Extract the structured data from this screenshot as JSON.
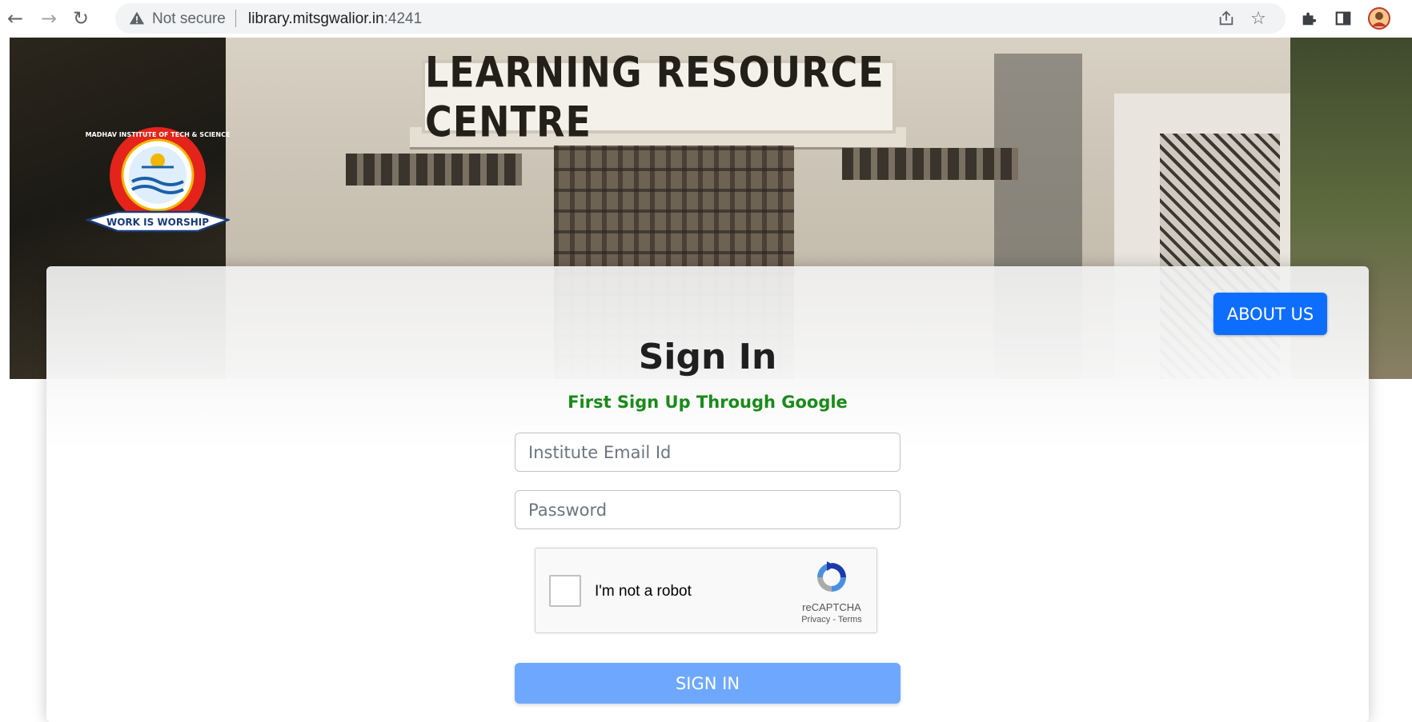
{
  "browser": {
    "back_icon": "arrow-left-icon",
    "forward_icon": "arrow-right-icon",
    "reload_icon": "reload-icon",
    "security_label": "Not secure",
    "url_host": "library.mitsgwalior.in",
    "url_port": ":4241",
    "share_icon": "share-icon",
    "bookmark_icon": "star-icon",
    "extensions_icon": "puzzle-icon",
    "sidepanel_icon": "side-panel-icon",
    "profile_icon": "profile-avatar-icon"
  },
  "hero": {
    "sign_text": "LEARNING RESOURCE CENTRE",
    "logo_top_text": "MADHAV INSTITUTE OF TECH & SCIENCE",
    "logo_motto": "WORK IS WORSHIP"
  },
  "card": {
    "about_label": "ABOUT US",
    "title": "Sign In",
    "subtitle": "First Sign Up Through Google",
    "email_placeholder": "Institute Email Id",
    "password_placeholder": "Password",
    "recaptcha": {
      "label": "I'm not a robot",
      "brand": "reCAPTCHA",
      "links": "Privacy - Terms"
    },
    "signin_label": "SIGN IN"
  },
  "colors": {
    "about_button": "#0d6efd",
    "signin_button": "#6ea8fe",
    "subtitle_green": "#1a8a1a"
  }
}
